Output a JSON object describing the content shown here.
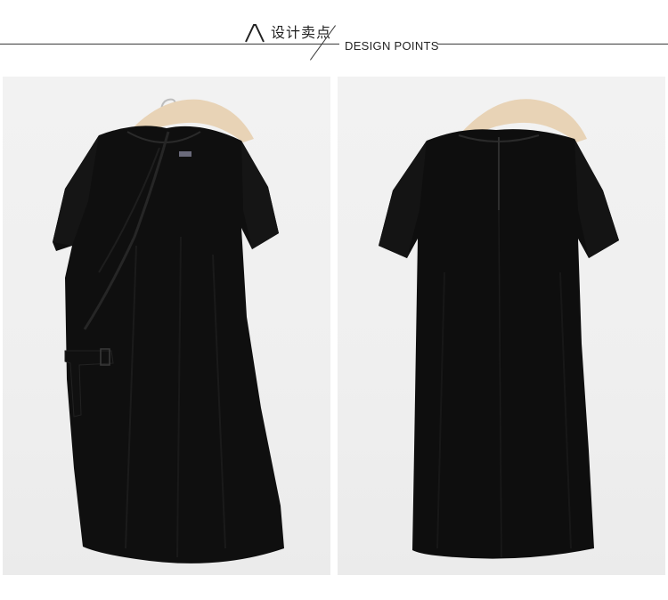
{
  "header": {
    "logo": "amii-logo-icon",
    "title_cn": "设计卖点",
    "title_en": "DESIGN POINTS"
  },
  "panels": [
    {
      "view": "front",
      "image": "black-dress-front"
    },
    {
      "view": "back",
      "image": "black-dress-back"
    }
  ],
  "colors": {
    "background": "#ffffff",
    "panel_bg": "#efefef",
    "dress": "#0e0e0e",
    "hanger": "#e7d1b3"
  }
}
